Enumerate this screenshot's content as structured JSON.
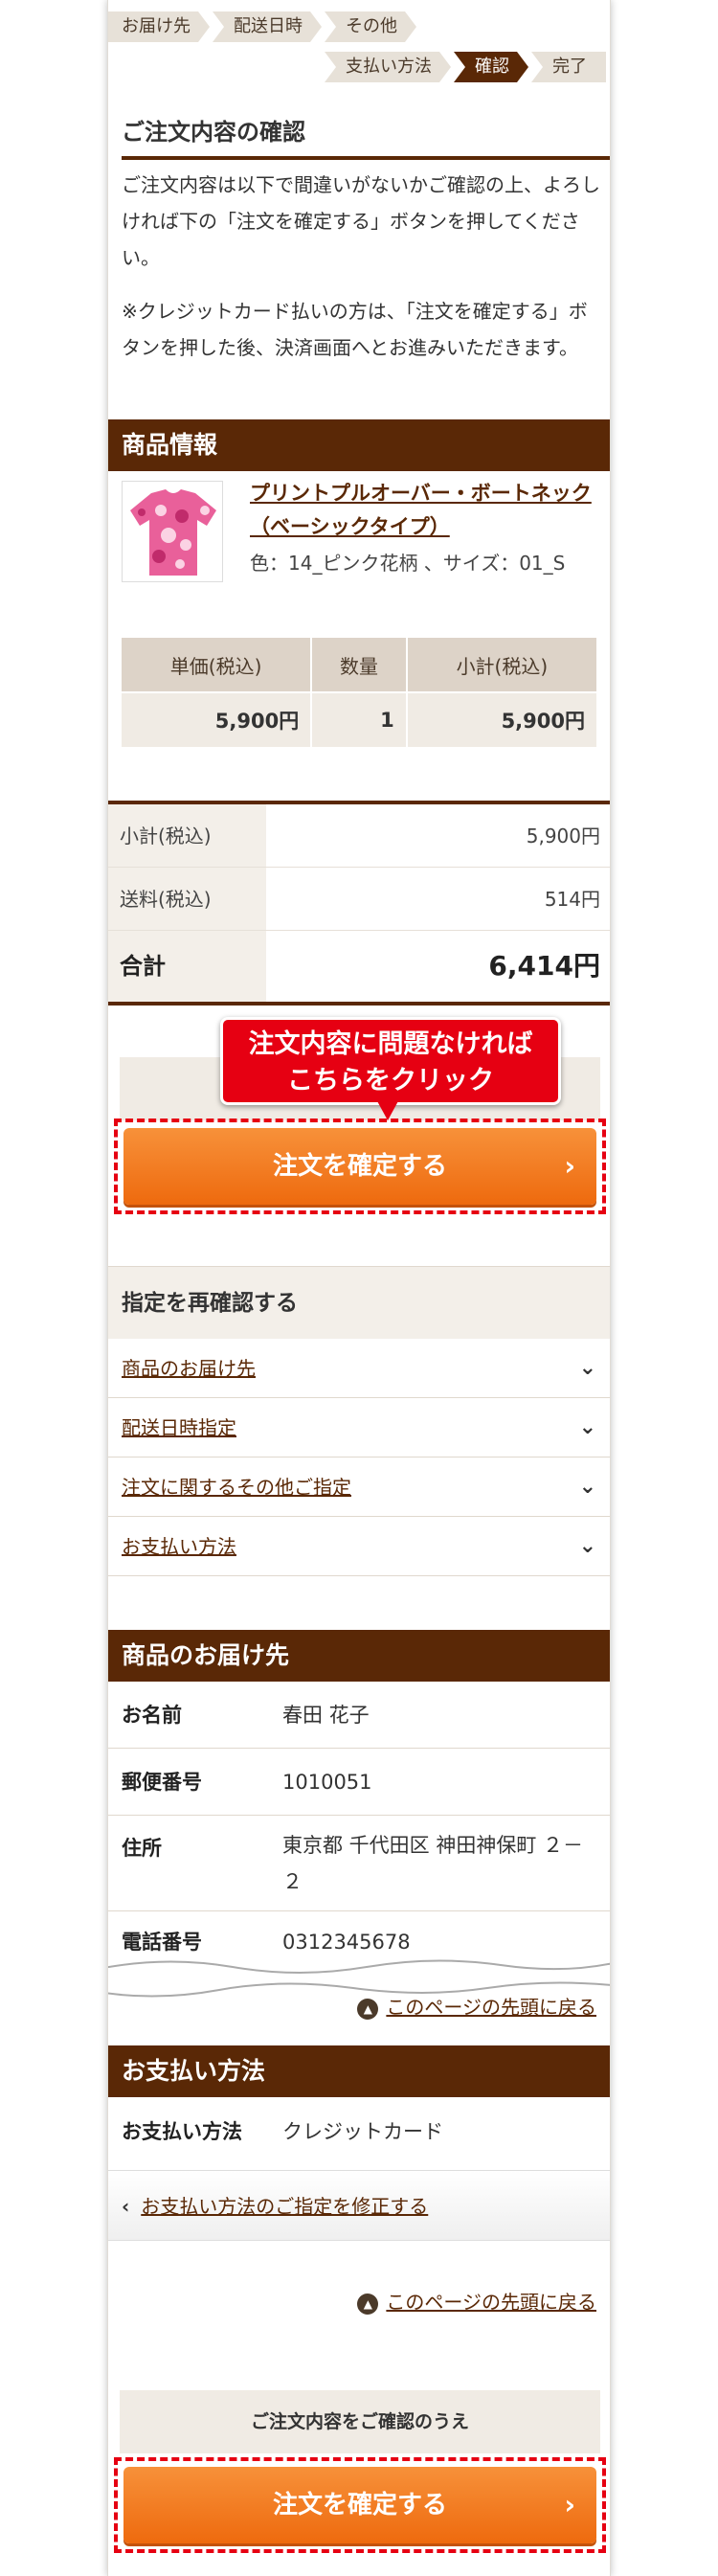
{
  "steps": {
    "row1": [
      "お届け先",
      "配送日時",
      "その他"
    ],
    "row2": [
      "支払い方法",
      "確認",
      "完了"
    ],
    "active": "確認"
  },
  "confirm_section": {
    "title": "ご注文内容の確認",
    "para1": "ご注文内容は以下で間違いがないかご確認の上、よろしければ下の「注文を確定する」ボタンを押してください。",
    "para2": "※クレジットカード払いの方は、「注文を確定する」ボタンを押した後、決済画面へとお進みいただきます。"
  },
  "product": {
    "heading": "商品情報",
    "name": "プリントプルオーバー・ボートネック（ベーシックタイプ）",
    "attributes": "色：14_ピンク花柄 、サイズ：01_S",
    "table_headers": [
      "単価(税込)",
      "数量",
      "小計(税込)"
    ],
    "unit_price": "5,900円",
    "quantity": "1",
    "subtotal": "5,900円"
  },
  "totals": {
    "subtotal_label": "小計(税込)",
    "subtotal_value": "5,900円",
    "shipping_label": "送料(税込)",
    "shipping_value": "514円",
    "total_label": "合計",
    "total_value": "6,414円"
  },
  "callout": {
    "line1": "注文内容に問題なければ",
    "line2": "こちらをクリック"
  },
  "confirm_box_text": "ご注文内容をご確認のうえ",
  "confirm_box_text_top_visible": "ご注文内容",
  "confirm_button_label": "注文を確定する",
  "recheck": {
    "heading": "指定を再確認する",
    "items": [
      "商品のお届け先",
      "配送日時指定",
      "注文に関するその他ご指定",
      "お支払い方法"
    ]
  },
  "delivery": {
    "heading": "商品のお届け先",
    "name_label": "お名前",
    "name_value": "春田 花子",
    "zip_label": "郵便番号",
    "zip_value": "1010051",
    "address_label": "住所",
    "address_value": "東京都 千代田区 神田神保町 ２－２",
    "phone_label": "電話番号",
    "phone_value": "0312345678"
  },
  "back_to_top": "このページの先頭に戻る",
  "payment": {
    "heading": "お支払い方法",
    "label": "お支払い方法",
    "value": "クレジットカード",
    "modify_link": "お支払い方法のご指定を修正する"
  },
  "icons": {
    "chevron_right": "chevron-right-icon",
    "chevron_double_down": "chevron-double-down-icon",
    "arrow_up_circle": "arrow-up-circle-icon",
    "chevron_left": "chevron-left-icon"
  },
  "colors": {
    "brand_brown": "#5a2806",
    "button_orange": "#f07a1c",
    "callout_red": "#e60012"
  }
}
